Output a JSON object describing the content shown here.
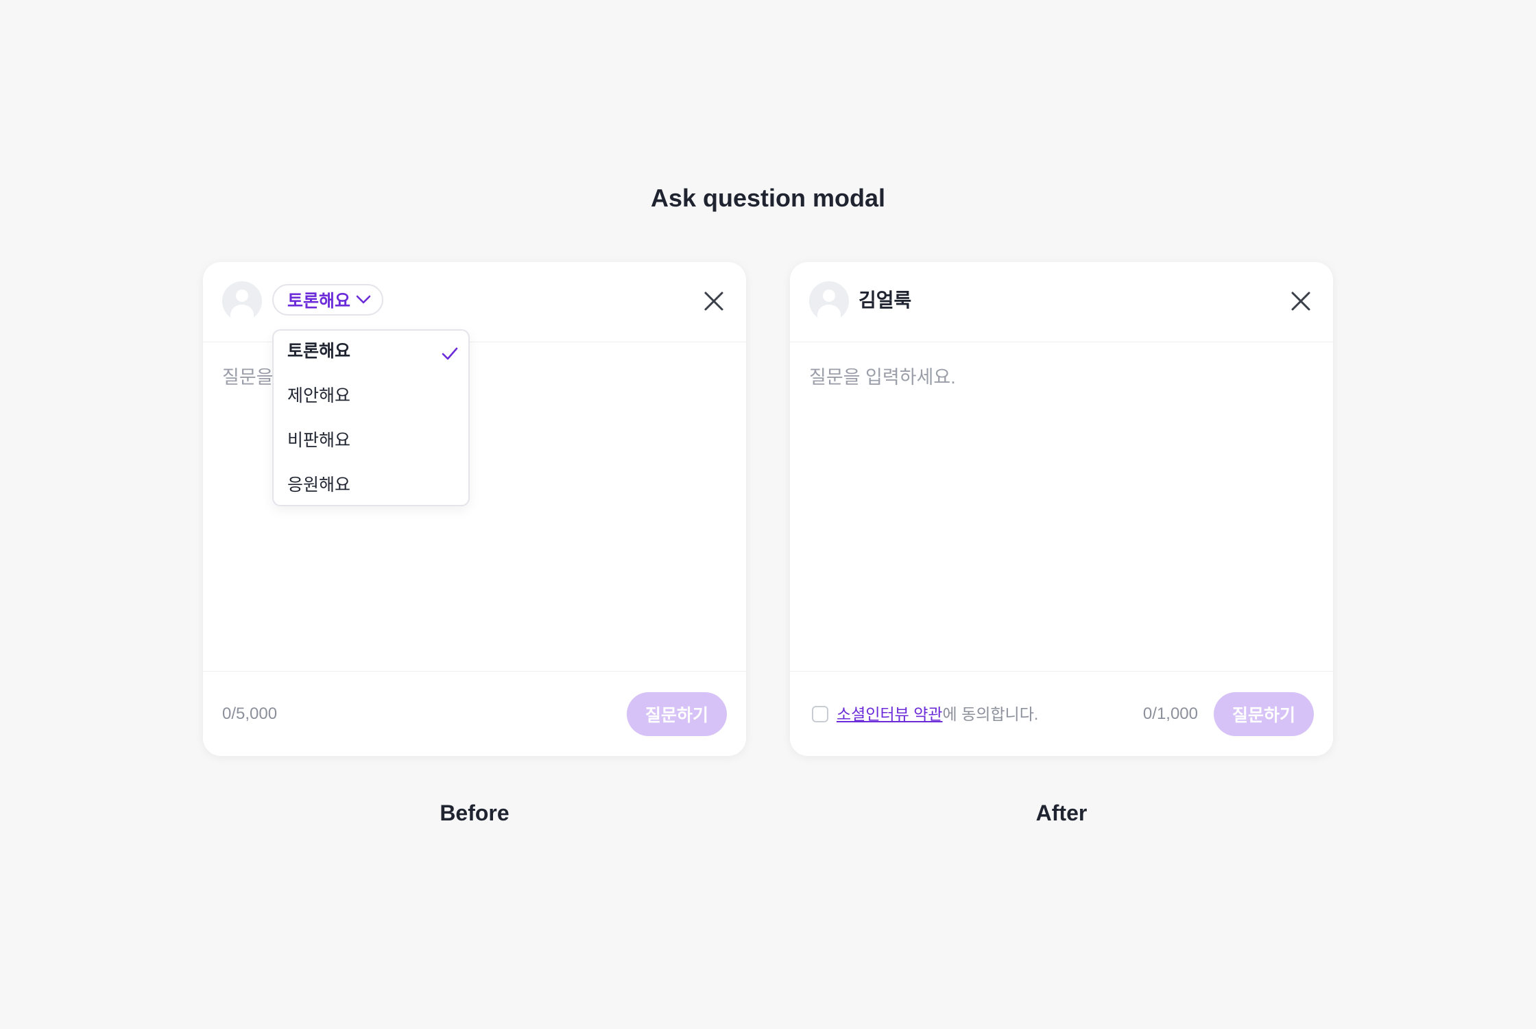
{
  "page": {
    "title": "Ask question modal",
    "before_caption": "Before",
    "after_caption": "After"
  },
  "colors": {
    "accent": "#6b2bd9",
    "submit_disabled": "#d6c2f6",
    "background": "#f7f7f8",
    "placeholder": "#9a9ea8"
  },
  "before": {
    "category": {
      "selected": "토론해요",
      "options": [
        "토론해요",
        "제안해요",
        "비판해요",
        "응원해요"
      ],
      "dropdown_open": true
    },
    "question_placeholder": "질문을 입력하세요.",
    "counter": "0/5,000",
    "submit_label": "질문하기",
    "icons": {
      "avatar": "user-avatar-icon",
      "close": "close-icon",
      "chevron": "chevron-down-icon",
      "check": "check-icon"
    }
  },
  "after": {
    "user_name": "김얼룩",
    "question_placeholder": "질문을 입력하세요.",
    "terms_link": "소셜인터뷰 약관",
    "terms_rest": "에 동의합니다.",
    "terms_checked": false,
    "counter": "0/1,000",
    "submit_label": "질문하기",
    "icons": {
      "avatar": "user-avatar-icon",
      "close": "close-icon"
    }
  }
}
